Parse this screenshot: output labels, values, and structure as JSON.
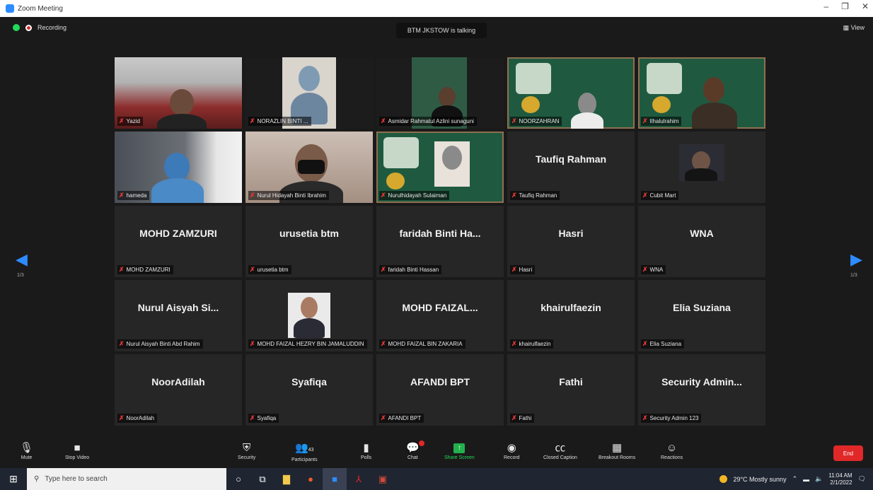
{
  "window": {
    "title": "Zoom Meeting",
    "controls": [
      "–",
      "❐",
      "✕"
    ]
  },
  "top": {
    "recording": "Recording",
    "talking": "BTM JKSTOW is talking",
    "view": "View"
  },
  "pager": {
    "left": "1/3",
    "right": "1/3"
  },
  "tiles": [
    {
      "label": "Yazid",
      "video": true
    },
    {
      "label": "NORAZLIN BINTI ...",
      "video": true
    },
    {
      "label": "Asmidar Rahmatul Azlini sunaguni",
      "video": true
    },
    {
      "label": "NOORZAHRAN",
      "video": true
    },
    {
      "label": "Ilhalulrahim",
      "video": true
    },
    {
      "label": "hameda",
      "video": true
    },
    {
      "label": "Nurul Hidayah Binti Ibrahim",
      "video": true
    },
    {
      "label": "Nurulhidayah Sulaiman",
      "video": true
    },
    {
      "name": "Taufiq Rahman",
      "label": "Taufiq Rahman"
    },
    {
      "label": "Cubit Mart",
      "video": true
    },
    {
      "name": "MOHD ZAMZURI",
      "label": "MOHD ZAMZURI"
    },
    {
      "name": "urusetia btm",
      "label": "urusetia btm"
    },
    {
      "name": "faridah Binti Ha...",
      "label": "faridah Binti Hassan"
    },
    {
      "name": "Hasri",
      "label": "Hasri"
    },
    {
      "name": "WNA",
      "label": "WNA"
    },
    {
      "name": "Nurul Aisyah Si...",
      "label": "Nurul Aisyah Binti Abd Rahim"
    },
    {
      "label": "MOHD FAIZAL HEZRY BIN JAMALUDDIN",
      "photo": true
    },
    {
      "name": "MOHD FAIZAL...",
      "label": "MOHD FAIZAL BIN ZAKARIA"
    },
    {
      "name": "khairulfaezin",
      "label": "khairulfaezin"
    },
    {
      "name": "Elia Suziana",
      "label": "Elia Suziana"
    },
    {
      "name": "NoorAdilah",
      "label": "NoorAdilah"
    },
    {
      "name": "Syafiqa",
      "label": "Syafiqa"
    },
    {
      "name": "AFANDI BPT",
      "label": "AFANDI BPT"
    },
    {
      "name": "Fathi",
      "label": "Fathi"
    },
    {
      "name": "Security Admin...",
      "label": "Security Admin 123"
    }
  ],
  "toolbar": {
    "mute": "Mute",
    "video": "Stop Video",
    "security": "Security",
    "participants": "Participants",
    "participants_count": "43",
    "polls": "Polls",
    "chat": "Chat",
    "share": "Share Screen",
    "record": "Record",
    "captions": "Closed Caption",
    "breakout": "Breakout Rooms",
    "reactions": "Reactions",
    "end": "End"
  },
  "taskbar": {
    "search_placeholder": "Type here to search",
    "weather": "29°C Mostly sunny",
    "time": "11:04 AM",
    "date": "2/1/2022"
  }
}
